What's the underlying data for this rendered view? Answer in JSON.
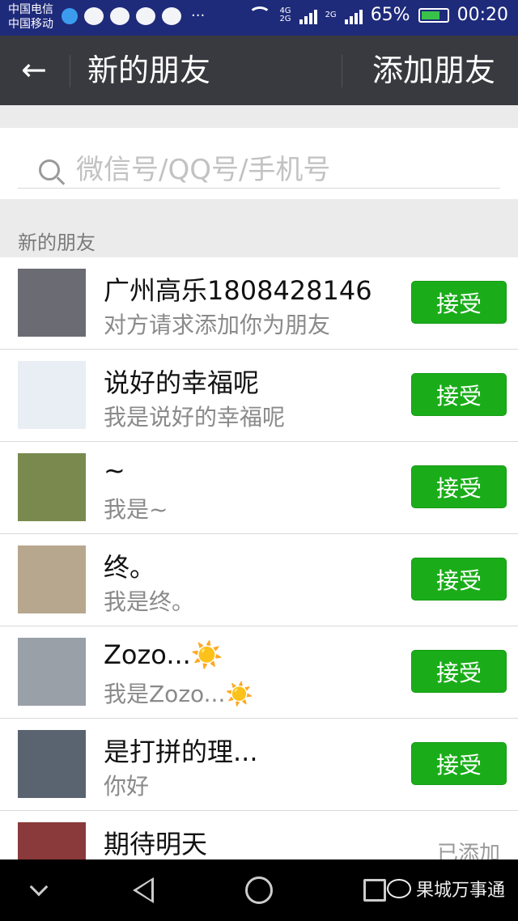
{
  "status_bar": {
    "carrier_1": "中国电信",
    "carrier_2": "中国移动",
    "network_1": "4G",
    "network_2": "2G",
    "network_3": "2G",
    "battery": "65%",
    "time": "00:20",
    "more": "···"
  },
  "header": {
    "back_icon": "arrow-left-icon",
    "title": "新的朋友",
    "add_label": "添加朋友"
  },
  "search": {
    "placeholder": "微信号/QQ号/手机号"
  },
  "section_label": "新的朋友",
  "accept_label": "接受",
  "requests": [
    {
      "name": "广州高乐1808428146",
      "message": "对方请求添加你为朋友",
      "avatar_color": "#6b6b73"
    },
    {
      "name": "说好的幸福呢",
      "message": "我是说好的幸福呢",
      "avatar_color": "#e8eef4"
    },
    {
      "name": "~",
      "message": "我是~",
      "avatar_color": "#7a8a4f"
    },
    {
      "name": "终。",
      "message": "我是终。",
      "avatar_color": "#b7a78e"
    },
    {
      "name": "Zozo...☀️",
      "message": "我是Zozo...☀️",
      "avatar_color": "#9aa0a8"
    },
    {
      "name": "是打拼的理...",
      "message": "你好",
      "avatar_color": "#5a6470"
    }
  ],
  "last_item": {
    "name": "期待明天",
    "status": "已添加",
    "avatar_color": "#8a3a3a"
  },
  "watermark": "果城万事通"
}
